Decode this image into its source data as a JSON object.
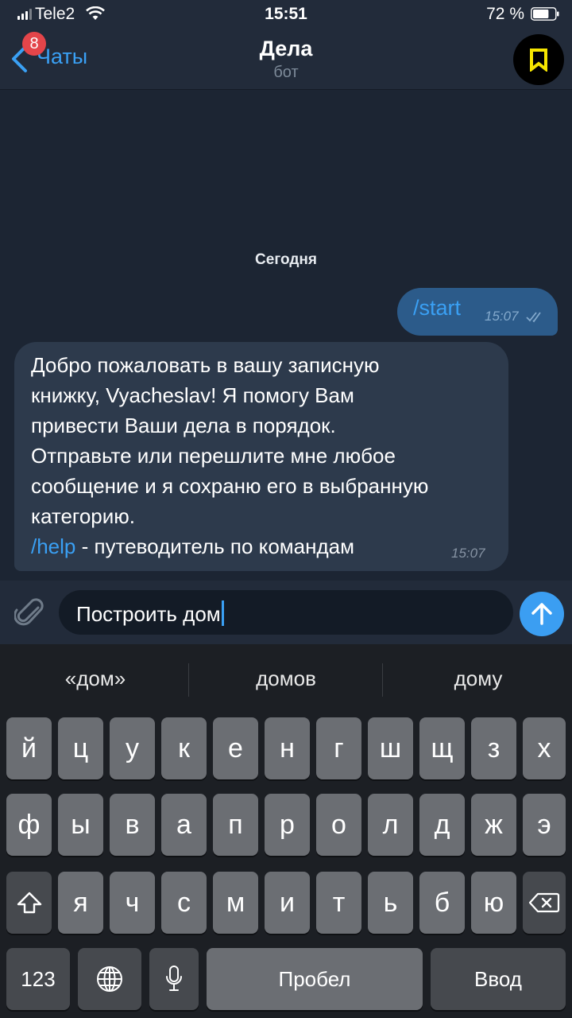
{
  "status_bar": {
    "carrier": "Tele2",
    "time": "15:51",
    "battery_percent": "72 %",
    "battery_level": 0.72
  },
  "nav": {
    "back_label": "Чаты",
    "unread_badge": "8",
    "title": "Дела",
    "subtitle": "бот",
    "avatar_icon": "bookmark-icon",
    "avatar_icon_color": "#f5e500"
  },
  "messages": {
    "date_label": "Сегодня",
    "outgoing": {
      "text": "/start",
      "time": "15:07"
    },
    "incoming": {
      "lines": [
        "Добро пожаловать в вашу записную",
        "книжку, Vyacheslav! Я помогу Вам",
        "привести Ваши дела в порядок.",
        "Отправьте или перешлите мне любое",
        "сообщение и я сохраню его в выбранную",
        "категорию."
      ],
      "help_command": "/help",
      "help_text": " - путеводитель по командам",
      "time": "15:07"
    }
  },
  "input": {
    "value": "Построить дом"
  },
  "keyboard": {
    "suggestions": [
      "«дом»",
      "домов",
      "дому"
    ],
    "row1": [
      "й",
      "ц",
      "у",
      "к",
      "е",
      "н",
      "г",
      "ш",
      "щ",
      "з",
      "х"
    ],
    "row2": [
      "ф",
      "ы",
      "в",
      "а",
      "п",
      "р",
      "о",
      "л",
      "д",
      "ж",
      "э"
    ],
    "row3": [
      "я",
      "ч",
      "с",
      "м",
      "и",
      "т",
      "ь",
      "б",
      "ю"
    ],
    "numbers_key": "123",
    "space_key": "Пробел",
    "return_key": "Ввод"
  },
  "colors": {
    "accent": "#3aa0f4",
    "background": "#1c2533",
    "outgoing_bubble": "#2c5b8a",
    "incoming_bubble": "#2d3a4c",
    "badge": "#e4454a"
  }
}
